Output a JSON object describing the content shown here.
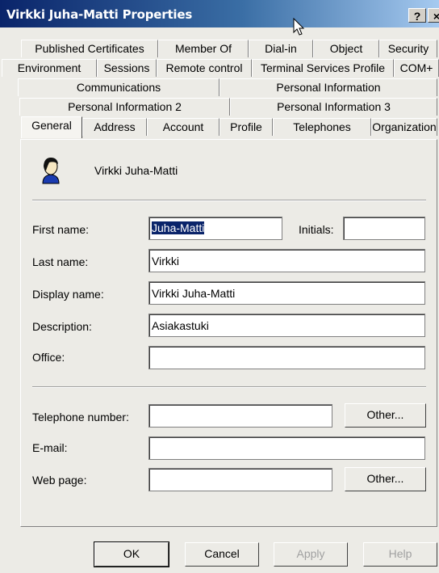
{
  "window": {
    "title": "Virkki Juha-Matti Properties",
    "help_label": "?",
    "close_label": "×"
  },
  "tabs": {
    "row1": [
      "Published Certificates",
      "Member Of",
      "Dial-in",
      "Object",
      "Security"
    ],
    "row2": [
      "Environment",
      "Sessions",
      "Remote control",
      "Terminal Services Profile",
      "COM+"
    ],
    "row3": [
      "Communications",
      "Personal Information"
    ],
    "row4": [
      "Personal Information 2",
      "Personal Information 3"
    ],
    "row5": [
      "General",
      "Address",
      "Account",
      "Profile",
      "Telephones",
      "Organization"
    ],
    "selected": "General"
  },
  "general": {
    "user_display": "Virkki Juha-Matti",
    "first_name_label": "First name:",
    "first_name_value": "Juha-Matti",
    "initials_label": "Initials:",
    "initials_value": "",
    "last_name_label": "Last name:",
    "last_name_value": "Virkki",
    "display_name_label": "Display name:",
    "display_name_value": "Virkki Juha-Matti",
    "description_label": "Description:",
    "description_value": "Asiakastuki",
    "office_label": "Office:",
    "office_value": "",
    "telephone_label": "Telephone number:",
    "telephone_value": "",
    "telephone_other_label": "Other...",
    "email_label": "E-mail:",
    "email_value": "",
    "webpage_label": "Web page:",
    "webpage_value": "",
    "webpage_other_label": "Other..."
  },
  "buttons": {
    "ok": "OK",
    "cancel": "Cancel",
    "apply": "Apply",
    "help": "Help"
  }
}
